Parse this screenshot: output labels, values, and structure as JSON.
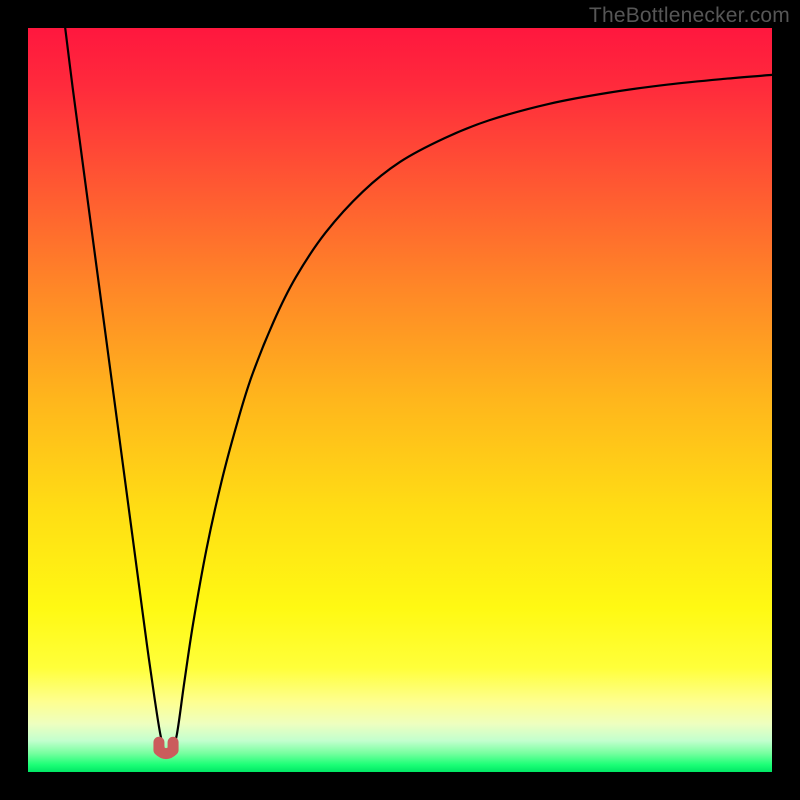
{
  "watermark": "TheBottlenecker.com",
  "chart_data": {
    "type": "line",
    "title": "",
    "xlabel": "",
    "ylabel": "",
    "xlim": [
      0,
      100
    ],
    "ylim": [
      0,
      100
    ],
    "background_gradient_stops": [
      {
        "offset": 0.0,
        "color": "#ff173e"
      },
      {
        "offset": 0.08,
        "color": "#ff2b3c"
      },
      {
        "offset": 0.2,
        "color": "#ff5433"
      },
      {
        "offset": 0.35,
        "color": "#ff8727"
      },
      {
        "offset": 0.5,
        "color": "#ffb61c"
      },
      {
        "offset": 0.65,
        "color": "#ffde14"
      },
      {
        "offset": 0.78,
        "color": "#fff913"
      },
      {
        "offset": 0.86,
        "color": "#ffff3a"
      },
      {
        "offset": 0.905,
        "color": "#feff8f"
      },
      {
        "offset": 0.935,
        "color": "#eeffbf"
      },
      {
        "offset": 0.958,
        "color": "#c2ffce"
      },
      {
        "offset": 0.975,
        "color": "#76ff9f"
      },
      {
        "offset": 0.99,
        "color": "#1dff77"
      },
      {
        "offset": 1.0,
        "color": "#00e765"
      }
    ],
    "series": [
      {
        "name": "bottleneck-curve",
        "color": "#000000",
        "width": 2.2,
        "x": [
          5.0,
          6.0,
          7.0,
          8.0,
          9.0,
          10.0,
          11.0,
          12.0,
          13.0,
          14.0,
          15.0,
          16.0,
          17.0,
          17.8,
          18.5,
          19.2,
          20.0,
          21.0,
          22.2,
          24.0,
          26.0,
          28.0,
          30.0,
          33.0,
          36.0,
          40.0,
          45.0,
          50.0,
          56.0,
          62.0,
          70.0,
          78.0,
          86.0,
          94.0,
          100.0
        ],
        "y": [
          100.0,
          92.0,
          84.5,
          77.0,
          69.5,
          62.0,
          54.5,
          47.0,
          39.5,
          32.0,
          24.5,
          17.0,
          10.0,
          5.0,
          2.5,
          2.5,
          5.0,
          12.0,
          20.0,
          30.0,
          39.0,
          46.5,
          53.0,
          60.5,
          66.5,
          72.5,
          78.0,
          82.0,
          85.2,
          87.6,
          89.8,
          91.3,
          92.4,
          93.2,
          93.7
        ]
      }
    ],
    "marker": {
      "name": "optimal-point",
      "color": "#cb5c5c",
      "stroke": "#cb5c5c",
      "x_range": [
        17.6,
        19.5
      ],
      "y": 2.4
    }
  }
}
